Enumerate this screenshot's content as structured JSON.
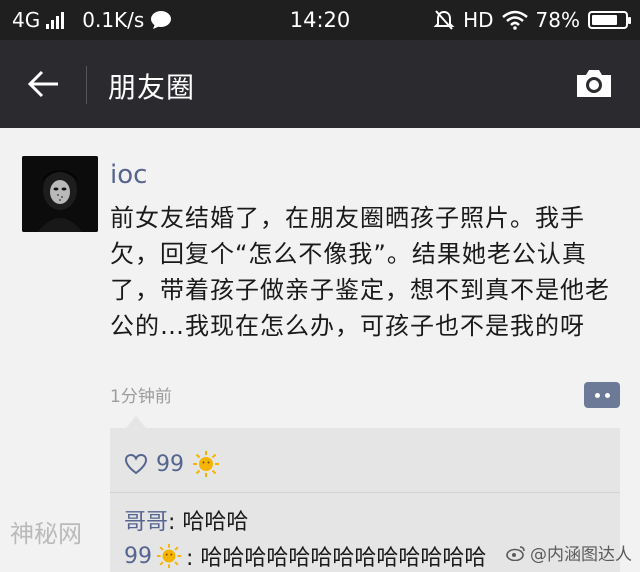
{
  "status_bar": {
    "network": "4G",
    "speed": "0.1K/s",
    "time": "14:20",
    "hd": "HD",
    "battery": "78%",
    "battery_level": 0.78
  },
  "nav": {
    "title": "朋友圈",
    "back_icon": "arrow-left-icon",
    "camera_icon": "camera-icon"
  },
  "post": {
    "username": "ioc",
    "text": "前女友结婚了，在朋友圈晒孩子照片。我手欠，回复个“怎么不像我”。结果她老公认真了，带着孩子做亲子鉴定，想不到真不是他老公的…我现在怎么办，可孩子也不是我的呀",
    "time": "1分钟前"
  },
  "reactions": {
    "like_count": "99",
    "comments": [
      {
        "author": "哥哥",
        "sep": ": ",
        "text": "哈哈哈"
      },
      {
        "prefix": "99",
        "sep": ": ",
        "text": "哈哈哈哈哈哈哈哈哈哈哈哈哈"
      }
    ]
  },
  "watermarks": {
    "left": "神秘网",
    "right": "@内涵图达人"
  },
  "colors": {
    "statusbar_bg": "#1f1f1f",
    "navbar_bg": "#2b2b2f",
    "link_blue": "#56658f",
    "sun": "#f5b400"
  }
}
